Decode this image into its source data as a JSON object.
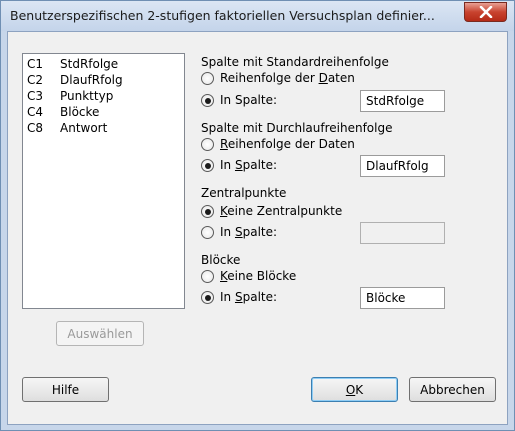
{
  "window": {
    "title": "Benutzerspezifischen 2-stufigen faktoriellen Versuchsplan definier..."
  },
  "columns": [
    {
      "id": "C1",
      "name": "StdRfolge"
    },
    {
      "id": "C2",
      "name": "DlaufRfolg"
    },
    {
      "id": "C3",
      "name": "Punkttyp"
    },
    {
      "id": "C4",
      "name": "Blöcke"
    },
    {
      "id": "C8",
      "name": "Antwort"
    }
  ],
  "select_button": "Auswählen",
  "std_order": {
    "label": "Spalte mit Standardreihenfolge",
    "opt_data_order": {
      "pre": "Reihenfolge der ",
      "key": "D",
      "post": "aten"
    },
    "opt_in_column": {
      "pre": "In ",
      "key": "",
      "post": "Spalte:"
    },
    "value": "StdRfolge"
  },
  "run_order": {
    "label": "Spalte mit Durchlaufreihenfolge",
    "opt_data_order": {
      "pre": "",
      "key": "R",
      "post": "eihenfolge der Daten"
    },
    "opt_in_column": {
      "pre": "In ",
      "key": "S",
      "post": "palte:"
    },
    "value": "DlaufRfolg"
  },
  "center_points": {
    "label": "Zentralpunkte",
    "opt_none": {
      "pre": "",
      "key": "K",
      "post": "eine Zentralpunkte"
    },
    "opt_in_column": {
      "pre": "In ",
      "key": "S",
      "post": "palte:"
    },
    "value": ""
  },
  "blocks": {
    "label": "Blöcke",
    "opt_none": {
      "pre": "",
      "key": "K",
      "post": "eine Blöcke"
    },
    "opt_in_column": {
      "pre": "In ",
      "key": "S",
      "post": "palte:"
    },
    "value": "Blöcke"
  },
  "buttons": {
    "help": "Hilfe",
    "ok": {
      "pre": "",
      "key": "O",
      "post": "K"
    },
    "cancel": "Abbrechen"
  }
}
